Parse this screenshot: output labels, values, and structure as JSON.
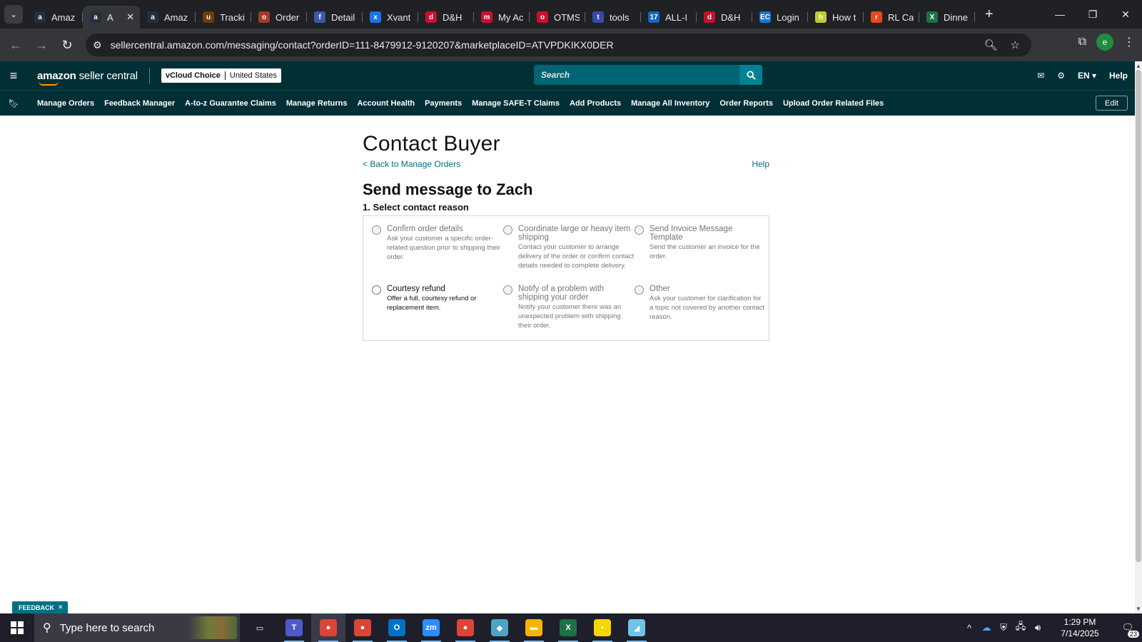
{
  "browser": {
    "tabs": [
      {
        "title": "Amaz",
        "icon": "amazon-icon",
        "color": "#232f3e",
        "glyph": "a"
      },
      {
        "title": "A",
        "icon": "amazon-icon",
        "color": "#232f3e",
        "glyph": "a",
        "active": true
      },
      {
        "title": "Amaz",
        "icon": "amazon-icon",
        "color": "#232f3e",
        "glyph": "a"
      },
      {
        "title": "Tracki",
        "icon": "ups-icon",
        "color": "#6b3e0a",
        "glyph": "u"
      },
      {
        "title": "Order",
        "icon": "order-icon",
        "color": "#a33a2a",
        "glyph": "o"
      },
      {
        "title": "Detail",
        "icon": "flag-icon",
        "color": "#3a5aa8",
        "glyph": "f"
      },
      {
        "title": "Xvant",
        "icon": "xvant-icon",
        "color": "#1a73e8",
        "glyph": "x"
      },
      {
        "title": "D&H",
        "icon": "dh-icon",
        "color": "#c8102e",
        "glyph": "d"
      },
      {
        "title": "My Ac",
        "icon": "myac-icon",
        "color": "#c8102e",
        "glyph": "m"
      },
      {
        "title": "OTMS",
        "icon": "otms-icon",
        "color": "#c8102e",
        "glyph": "o"
      },
      {
        "title": "tools",
        "icon": "tools-icon",
        "color": "#3949ab",
        "glyph": "t"
      },
      {
        "title": "ALL-I",
        "icon": "seventeen-icon",
        "color": "#1565c0",
        "glyph": "17"
      },
      {
        "title": "D&H",
        "icon": "dh-icon",
        "color": "#c8102e",
        "glyph": "d"
      },
      {
        "title": "Login",
        "icon": "ec-icon",
        "color": "#1976d2",
        "glyph": "EC"
      },
      {
        "title": "How t",
        "icon": "howto-icon",
        "color": "#c0ca33",
        "glyph": "h"
      },
      {
        "title": "RL Ca",
        "icon": "rl-icon",
        "color": "#e64a19",
        "glyph": "r"
      },
      {
        "title": "Dinne",
        "icon": "excel-icon",
        "color": "#1e7145",
        "glyph": "X"
      }
    ],
    "url": "sellercentral.amazon.com/messaging/contact?orderID=111-8479912-9120207&marketplaceID=ATVPDKIKX0DER",
    "profile_initial": "e"
  },
  "header": {
    "logo_brand": "amazon",
    "logo_product": "seller central",
    "store_name": "vCloud Choice",
    "marketplace": "United States",
    "search_placeholder": "Search",
    "language": "EN",
    "help": "Help"
  },
  "nav": {
    "items": [
      "Manage Orders",
      "Feedback Manager",
      "A-to-z Guarantee Claims",
      "Manage Returns",
      "Account Health",
      "Payments",
      "Manage SAFE-T Claims",
      "Add Products",
      "Manage All Inventory",
      "Order Reports",
      "Upload Order Related Files"
    ],
    "edit": "Edit"
  },
  "main": {
    "title": "Contact Buyer",
    "back_link": "< Back to Manage Orders",
    "help_link": "Help",
    "send_title": "Send message to Zach",
    "step_label": "1. Select contact reason",
    "reasons": [
      {
        "label": "Confirm order details",
        "desc": "Ask your customer a specific order-related question prior to shipping their order.",
        "enabled": false
      },
      {
        "label": "Coordinate large or heavy item shipping",
        "desc": "Contact your customer to arrange delivery of the order or confirm contact details needed to complete delivery.",
        "enabled": false
      },
      {
        "label": "Send Invoice Message Template",
        "desc": "Send the customer an invoice for the order.",
        "enabled": false
      },
      {
        "label": "Courtesy refund",
        "desc": "Offer a full, courtesy refund or replacement item.",
        "enabled": true
      },
      {
        "label": "Notify of a problem with shipping your order",
        "desc": "Notify your customer there was an unexpected problem with shipping their order.",
        "enabled": false
      },
      {
        "label": "Other",
        "desc": "Ask your customer for clarification for a topic not covered by another contact reason.",
        "enabled": false
      }
    ]
  },
  "feedback": "FEEDBACK",
  "taskbar": {
    "search_placeholder": "Type here to search",
    "apps": [
      {
        "name": "task-view-icon",
        "color": "#1f1f2b",
        "glyph": "▭"
      },
      {
        "name": "teams-icon",
        "color": "#5059c9",
        "glyph": "T"
      },
      {
        "name": "chrome-icon",
        "color": "#db4437",
        "glyph": "●",
        "active": true
      },
      {
        "name": "chrome-profile-icon",
        "color": "#db4437",
        "glyph": "●"
      },
      {
        "name": "outlook-icon",
        "color": "#0072c6",
        "glyph": "O"
      },
      {
        "name": "zoom-icon",
        "color": "#2d8cff",
        "glyph": "zm"
      },
      {
        "name": "chrome-alt-icon",
        "color": "#db4437",
        "glyph": "●"
      },
      {
        "name": "app-diamond-icon",
        "color": "#4fa3c7",
        "glyph": "◆"
      },
      {
        "name": "file-explorer-icon",
        "color": "#f4b400",
        "glyph": "▬"
      },
      {
        "name": "excel-icon",
        "color": "#1e7145",
        "glyph": "X"
      },
      {
        "name": "sticky-notes-icon",
        "color": "#f7d600",
        "glyph": "▪"
      },
      {
        "name": "notepad-icon",
        "color": "#6ec3e8",
        "glyph": "◢"
      }
    ],
    "time": "1:29 PM",
    "date": "7/14/2025",
    "notification_count": "23"
  }
}
